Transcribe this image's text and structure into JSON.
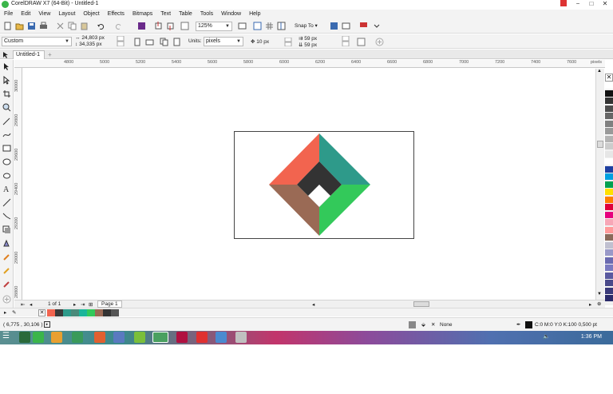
{
  "window": {
    "title": "CorelDRAW X7 (64-Bit) - Untitled-1",
    "minimize": "−",
    "maximize": "□",
    "close": "✕"
  },
  "menu": [
    "File",
    "Edit",
    "View",
    "Layout",
    "Object",
    "Effects",
    "Bitmaps",
    "Text",
    "Table",
    "Tools",
    "Window",
    "Help"
  ],
  "toolbar": {
    "zoom": "125%",
    "snap_to": "Snap To"
  },
  "propbar": {
    "page_size": "Custom",
    "width": "24,803 px",
    "height": "34,335 px",
    "units_label": "Units:",
    "units": "pixels",
    "nudge": "10 px",
    "dup_x": "59 px",
    "dup_y": "59 px"
  },
  "doc_tab": "Untitled-1",
  "ruler": {
    "h_ticks": [
      "4800",
      "5000",
      "5200",
      "5400",
      "5600",
      "5800",
      "6000",
      "6200",
      "6400",
      "6600",
      "6800",
      "7000",
      "7200",
      "7400",
      "7600"
    ],
    "h_unit": "pixels",
    "v_ticks": [
      "30000",
      "29800",
      "29600",
      "29400",
      "29200",
      "29000",
      "28800",
      "28600"
    ]
  },
  "artwork": {
    "colors": {
      "top_left": "#f2644f",
      "top_right": "#2e9a8a",
      "bottom_left": "#9a6a55",
      "bottom_right": "#33c95a",
      "inner_dark": "#333333",
      "inner_hole": "#ffffff"
    }
  },
  "page_nav": {
    "page_count": "1 of 1",
    "page_tab": "Page 1"
  },
  "doc_palette": [
    "#f2644f",
    "#3a3a3a",
    "#2e9a8a",
    "#4a8a7a",
    "#1bb59a",
    "#33c95a",
    "#9a6a55",
    "#333333",
    "#555555"
  ],
  "palette": [
    "#ffffff",
    "#111111",
    "#333333",
    "#4d4d4d",
    "#666666",
    "#808080",
    "#999999",
    "#b3b3b3",
    "#cccccc",
    "#e6e6e6",
    "#ffffff",
    "#1e3fa0",
    "#00a0e0",
    "#00a050",
    "#ffe000",
    "#ff7f00",
    "#e0003c",
    "#e6007e",
    "#f7a6b6",
    "#ff9a9a",
    "#8a6a5a",
    "#c0c0d0",
    "#9999c8",
    "#6a6ab0",
    "#7a7ac0",
    "#5a5aa0",
    "#4a4a8a",
    "#3a3a7a",
    "#2a2a6a"
  ],
  "status": {
    "coords": "( 6,775 , 30,106 )",
    "fill_label": "None",
    "outline": "C:0 M:0 Y:0 K:100  0,500 pt"
  },
  "taskbar": {
    "start_label": "☰",
    "clock": "1:36 PM"
  }
}
